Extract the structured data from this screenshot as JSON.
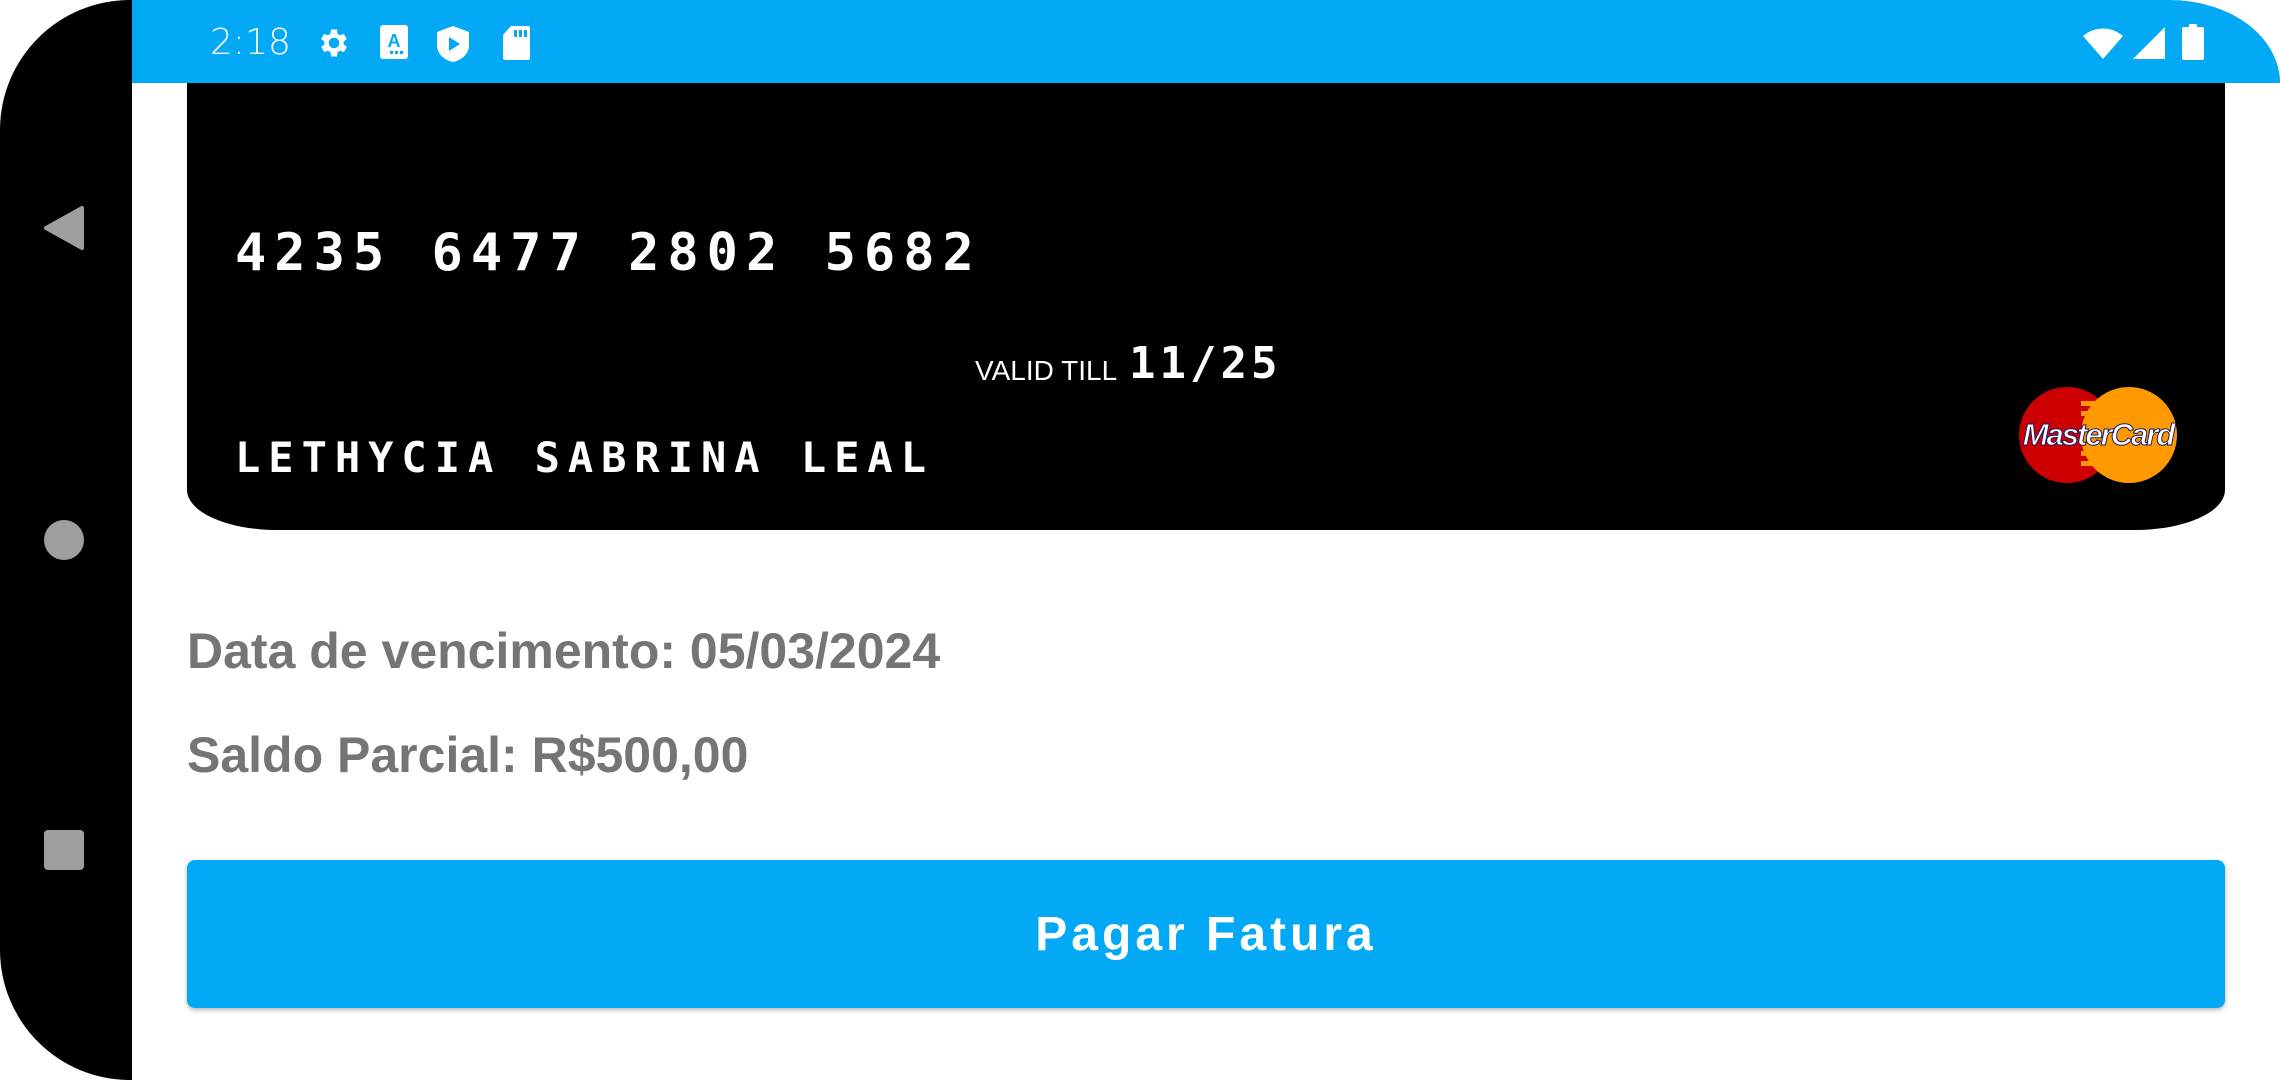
{
  "status_bar": {
    "time": "2:18",
    "left_icons": [
      "gear-icon",
      "font-a-icon",
      "shield-play-icon",
      "sd-card-icon"
    ],
    "right_icons": [
      "wifi-icon",
      "signal-icon",
      "battery-icon"
    ],
    "color": "#03A9F4"
  },
  "nav_bar": {
    "buttons": [
      "back",
      "home",
      "recents"
    ]
  },
  "card": {
    "number": "4235 6477 2802 5682",
    "valid_label": "VALID TILL",
    "valid_value": "11/25",
    "holder": "LETHYCIA SABRINA LEAL",
    "brand": "MasterCard"
  },
  "details": {
    "due_date": "Data de vencimento: 05/03/2024",
    "partial_balance": "Saldo Parcial: R$500,00"
  },
  "actions": {
    "pay_label": "Pagar Fatura",
    "accent": "#03A9F4"
  }
}
